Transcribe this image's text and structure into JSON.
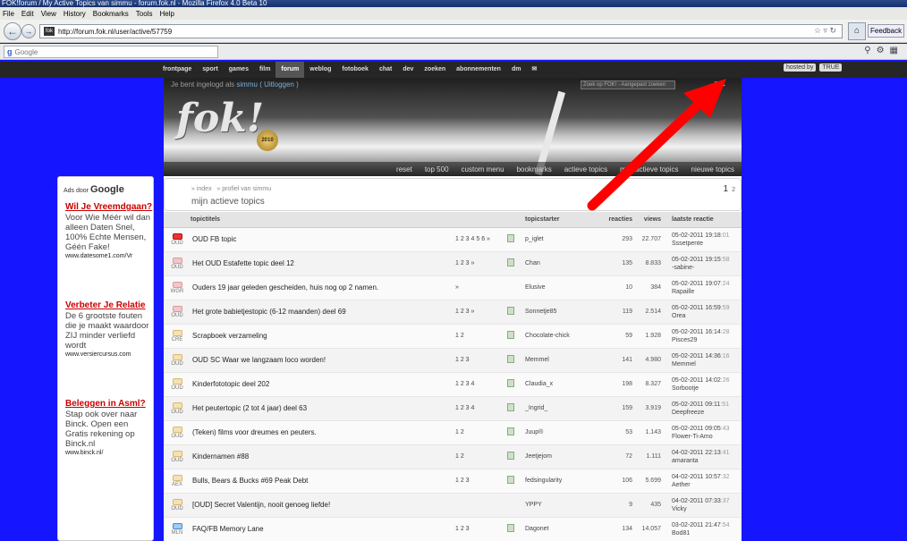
{
  "window": {
    "title": "FOK!forum / My Active Topics van simmu - forum.fok.nl - Mozilla Firefox 4.0 Beta 10"
  },
  "menu": [
    "File",
    "Edit",
    "View",
    "History",
    "Bookmarks",
    "Tools",
    "Help"
  ],
  "browser": {
    "url": "http://forum.fok.nl/user/active/57759",
    "search_placeholder": "Google",
    "feedback": "Feedback"
  },
  "site_nav": {
    "items": [
      "frontpage",
      "sport",
      "games",
      "film",
      "forum",
      "weblog",
      "fotoboek",
      "chat",
      "dev",
      "zoeken",
      "abonnementen",
      "dm"
    ],
    "active": "forum",
    "right_badges": [
      "hosted by",
      "TRUE"
    ]
  },
  "header": {
    "login_prefix": "Je bent ingelogd als ",
    "username": "simmu",
    "logout": "( Uitloggen )",
    "search_placeholder": "Zoek op FOK! - Aangepast zoeken",
    "logo_text": "fok!",
    "badge_text": "2010",
    "links": [
      "reset",
      "top 500",
      "custom menu",
      "bookmarks",
      "actieve topics",
      "mijn actieve topics",
      "nieuwe topics"
    ]
  },
  "breadcrumb": {
    "index": "» index",
    "profile": "» profiel van simmu",
    "page_title": "mijn actieve topics",
    "pages": [
      "1",
      "2"
    ]
  },
  "table": {
    "headers": {
      "title": "topictitels",
      "starter": "topicstarter",
      "replies": "reacties",
      "views": "views",
      "last": "laatste reactie"
    },
    "rows": [
      {
        "cat": "OUD",
        "fold": "r",
        "title": "OUD FB topic",
        "pages": "1 2 3 4 5 6 »",
        "starter": "p_iglet",
        "replies": "293",
        "views": "22.707",
        "date": "05-02-2011",
        "time": "19:18",
        "sec": ":01",
        "user": "Sssetpente"
      },
      {
        "cat": "OUD",
        "fold": "p",
        "title": "Het OUD Estafette topic deel 12",
        "pages": "1 2 3 »",
        "starter": "Chan",
        "replies": "135",
        "views": "8.833",
        "date": "05-02-2011",
        "time": "19:15",
        "sec": ":58",
        "user": "-sabine-"
      },
      {
        "cat": "WGR",
        "fold": "p",
        "title": "Ouders 19 jaar geleden gescheiden, huis nog op 2 namen.",
        "pages": "»",
        "starter": "Elusive",
        "replies": "10",
        "views": "384",
        "date": "05-02-2011",
        "time": "19:07",
        "sec": ":24",
        "user": "Rapaille"
      },
      {
        "cat": "OUD",
        "fold": "p",
        "title": "Het grote babietjestopic (6-12 maanden) deel 69",
        "pages": "1 2 3 »",
        "starter": "Sonnetje85",
        "replies": "119",
        "views": "2.514",
        "date": "05-02-2011",
        "time": "16:59",
        "sec": ":59",
        "user": "Orea"
      },
      {
        "cat": "CRE",
        "fold": "y",
        "title": "Scrapboek verzameling",
        "pages": "1 2",
        "starter": "Chocolate-chick",
        "replies": "59",
        "views": "1.928",
        "date": "05-02-2011",
        "time": "16:14",
        "sec": ":28",
        "user": "Pisces29"
      },
      {
        "cat": "OUD",
        "fold": "y",
        "title": "OUD SC Waar we langzaam loco worden!",
        "pages": "1 2 3",
        "starter": "Memmel",
        "replies": "141",
        "views": "4.980",
        "date": "05-02-2011",
        "time": "14:36",
        "sec": ":16",
        "user": "Memmel"
      },
      {
        "cat": "OUD",
        "fold": "y",
        "title": "Kinderfototopic deel 202",
        "pages": "1 2 3 4",
        "starter": "Claudia_x",
        "replies": "198",
        "views": "8.327",
        "date": "05-02-2011",
        "time": "14:02",
        "sec": ":26",
        "user": "Sorbootje"
      },
      {
        "cat": "OUD",
        "fold": "y",
        "title": "Het peutertopic (2 tot 4 jaar) deel 63",
        "pages": "1 2 3 4",
        "starter": "_Ingrid_",
        "replies": "159",
        "views": "3.919",
        "date": "05-02-2011",
        "time": "09:11",
        "sec": ":51",
        "user": "Deepfreeze"
      },
      {
        "cat": "OUD",
        "fold": "y",
        "title": "(Teken) films voor dreumes en peuters.",
        "pages": "1 2",
        "starter": "Juup®",
        "replies": "53",
        "views": "1.143",
        "date": "05-02-2011",
        "time": "09:05",
        "sec": ":43",
        "user": "Flower-Ti-Amo"
      },
      {
        "cat": "OUD",
        "fold": "y",
        "title": "Kindernamen #88",
        "pages": "1 2",
        "starter": "Jeetjejom",
        "replies": "72",
        "views": "1.111",
        "date": "04-02-2011",
        "time": "22:13",
        "sec": ":41",
        "user": "amaranta"
      },
      {
        "cat": "AEX",
        "fold": "y",
        "title": "Bulls, Bears & Bucks #69 Peak Debt",
        "pages": "1 2 3",
        "starter": "fedsingularity",
        "replies": "106",
        "views": "5.699",
        "date": "04-02-2011",
        "time": "10:57",
        "sec": ":32",
        "user": "Aether"
      },
      {
        "cat": "OUD",
        "fold": "y",
        "title": "[OUD] Secret Valentijn, nooit genoeg liefde!",
        "pages": "",
        "starter": "YPPY",
        "replies": "9",
        "views": "435",
        "date": "04-02-2011",
        "time": "07:33",
        "sec": ":37",
        "user": "Vicky"
      },
      {
        "cat": "MLN",
        "fold": "b",
        "title": "FAQ/FB Memory Lane",
        "pages": "1 2 3",
        "starter": "Dagonet",
        "replies": "134",
        "views": "14.057",
        "date": "03-02-2011",
        "time": "21:47",
        "sec": ":54",
        "user": "Bod81"
      }
    ]
  },
  "ads": {
    "header_prefix": "Ads door ",
    "header_brand": "Google",
    "items": [
      {
        "title": "Wil Je Vreemdgaan?",
        "body": "Voor Wie Méér wil dan alleen Daten Snel, 100% Echte Mensen, Géén Fake!",
        "url": "www.datesome1.com/Vr"
      },
      {
        "title": "Verbeter Je Relatie",
        "body": "De 6 grootste fouten die je maakt waardoor ZIJ minder verliefd wordt",
        "url": "www.versiercursus.com"
      },
      {
        "title": "Beleggen in Asml?",
        "body": "Stap ook over naar Binck. Open een Gratis rekening op Binck.nl",
        "url": "www.binck.nl/"
      }
    ]
  },
  "colors": {
    "page_bg": "#1515ff",
    "arrow": "#ff0000",
    "ad_title": "#cc0000"
  }
}
